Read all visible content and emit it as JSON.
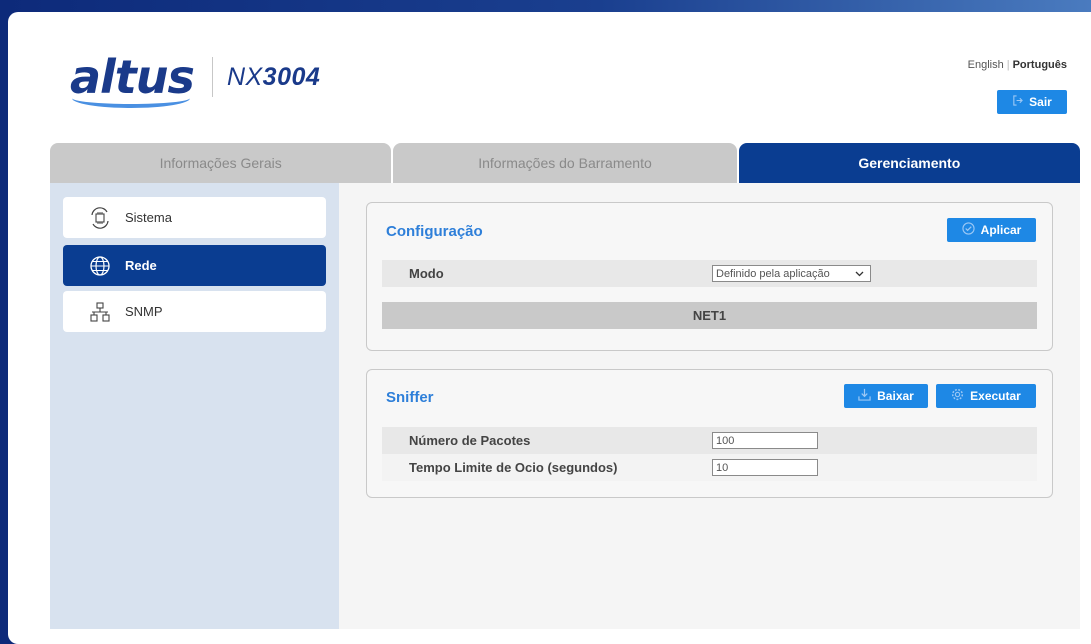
{
  "header": {
    "brand": "altus",
    "model_prefix": "NX",
    "model_number": "3004",
    "lang_english": "English",
    "lang_sep": "|",
    "lang_portugues": "Português",
    "logout_label": "Sair"
  },
  "tabs": [
    {
      "label": "Informações Gerais"
    },
    {
      "label": "Informações do Barramento"
    },
    {
      "label": "Gerenciamento"
    }
  ],
  "sidebar": {
    "items": [
      {
        "label": "Sistema",
        "icon": "system-icon"
      },
      {
        "label": "Rede",
        "icon": "globe-icon"
      },
      {
        "label": "SNMP",
        "icon": "network-icon"
      }
    ]
  },
  "config": {
    "title": "Configuração",
    "apply_label": "Aplicar",
    "mode_label": "Modo",
    "mode_value": "Definido pela aplicação",
    "net_label": "NET1"
  },
  "sniffer": {
    "title": "Sniffer",
    "download_label": "Baixar",
    "run_label": "Executar",
    "packets_label": "Número de Pacotes",
    "packets_value": "100",
    "timeout_label": "Tempo Limite de Ocio (segundos)",
    "timeout_value": "10"
  },
  "colors": {
    "primary": "#0a3d91",
    "accent": "#1e88e5",
    "title_blue": "#2e7fd9",
    "sidebar_bg": "#d8e2ef"
  }
}
